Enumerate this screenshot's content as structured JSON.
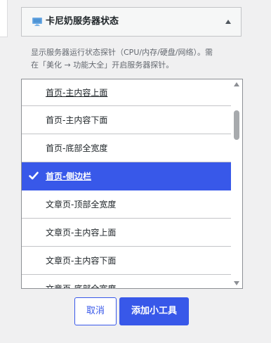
{
  "widget": {
    "title": "卡尼奶服务器状态",
    "description_line1": "显示服务器运行状态探针（CPU/内存/硬盘/网络）。需",
    "description_line2": "在「美化 → 功能大全」开启服务器探针。"
  },
  "options": [
    {
      "label": "首页-主内容上面",
      "selected": false,
      "underline": true
    },
    {
      "label": "首页-主内容下面",
      "selected": false,
      "underline": false
    },
    {
      "label": "首页-底部全宽度",
      "selected": false,
      "underline": false
    },
    {
      "label": "首页-侧边栏",
      "selected": true,
      "underline": true
    },
    {
      "label": "文章页-顶部全宽度",
      "selected": false,
      "underline": false
    },
    {
      "label": "文章页-主内容上面",
      "selected": false,
      "underline": false
    },
    {
      "label": "文章页-主内容下面",
      "selected": false,
      "underline": false
    },
    {
      "label": "文章页-底部全宽度",
      "selected": false,
      "underline": false
    }
  ],
  "buttons": {
    "cancel": "取消",
    "add": "添加小工具"
  },
  "colors": {
    "accent": "#3858e9",
    "icon_blue": "#72aee6"
  }
}
